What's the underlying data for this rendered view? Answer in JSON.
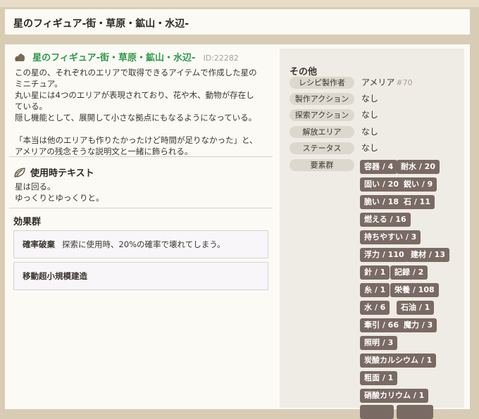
{
  "header": {
    "title": "星のフィギュア-街・草原・鉱山・水辺-"
  },
  "item": {
    "name": "星のフィギュア-街・草原・鉱山・水辺-",
    "id": "ID:22282",
    "description": "この星の、それぞれのエリアで取得できるアイテムで作成した星の\nミニチュア。\n丸い星には4つのエリアが表現されており、花や木、動物が存在し\nている。\n隠し機能として、展開して小さな拠点にもなるようになっている。\n\n「本当は他のエリアも作りたかったけど時間が足りなかった」と、\nアメリアの残念そうな説明文と一緒に飾られる。"
  },
  "usage": {
    "title": "使用時テキスト",
    "text": "星は回る。\nゆっくりとゆっくりと。"
  },
  "effects": {
    "title": "効果群",
    "items": [
      {
        "name": "確率破棄",
        "detail": "探索に使用時、20%の確率で壊れてしまう。"
      },
      {
        "name": "移動超小規模建造",
        "detail": ""
      }
    ]
  },
  "other": {
    "title": "その他",
    "rows": [
      {
        "label": "レシピ製作者",
        "value": "アメリア",
        "num": "#70"
      },
      {
        "label": "製作アクション",
        "value": "なし"
      },
      {
        "label": "探索アクション",
        "value": "なし"
      },
      {
        "label": "解放エリア",
        "value": "なし"
      },
      {
        "label": "ステータス",
        "value": "なし"
      },
      {
        "label": "要素群",
        "value": ""
      }
    ],
    "tags": [
      "容器 / 4",
      "耐水 / 20",
      "固い / 20",
      "鋭い / 9",
      "脆い / 18",
      "石 / 11",
      "燃える / 16",
      "持ちやすい / 3",
      "浮力 / 110",
      "建材 / 13",
      "針 / 1",
      "記録 / 2",
      "糸 / 1",
      "栄養 / 108",
      "水 / 6",
      "石油 / 1",
      "牽引 / 66",
      "魔力 / 3",
      "照明 / 3",
      "炭酸カルシウム / 1",
      "粗面 / 1",
      "硝酸カリウム / 1"
    ]
  },
  "icons": {
    "item": "ore-pouch-icon",
    "usage": "shell-icon"
  },
  "colors": {
    "item_name": "#2f9a4a",
    "tag_bg": "#7a6a64",
    "pill_bg": "#ddd8cd"
  }
}
